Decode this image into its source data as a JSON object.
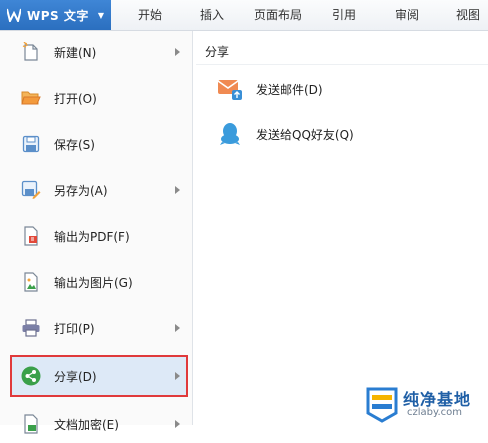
{
  "app_menu": {
    "title": "WPS 文字",
    "caret": "▼"
  },
  "ribbon_tabs": [
    {
      "label": "开始"
    },
    {
      "label": "插入"
    },
    {
      "label": "页面布局"
    },
    {
      "label": "引用"
    },
    {
      "label": "审阅"
    },
    {
      "label": "视图"
    }
  ],
  "file_menu": {
    "items": [
      {
        "label": "新建(N)",
        "icon": "new-document-icon",
        "has_submenu": true
      },
      {
        "label": "打开(O)",
        "icon": "folder-open-icon",
        "has_submenu": false
      },
      {
        "label": "保存(S)",
        "icon": "save-icon",
        "has_submenu": false
      },
      {
        "label": "另存为(A)",
        "icon": "save-as-icon",
        "has_submenu": true
      },
      {
        "label": "输出为PDF(F)",
        "icon": "pdf-export-icon",
        "has_submenu": false
      },
      {
        "label": "输出为图片(G)",
        "icon": "image-export-icon",
        "has_submenu": false
      },
      {
        "label": "打印(P)",
        "icon": "printer-icon",
        "has_submenu": true
      },
      {
        "label": "分享(D)",
        "icon": "share-icon",
        "has_submenu": true,
        "selected": true
      },
      {
        "label": "文档加密(E)",
        "icon": "encrypt-icon",
        "has_submenu": true
      }
    ]
  },
  "share_submenu": {
    "title": "分享",
    "items": [
      {
        "label": "发送邮件(D)",
        "icon": "mail-send-icon"
      },
      {
        "label": "发送给QQ好友(Q)",
        "icon": "qq-icon"
      }
    ]
  },
  "watermark": {
    "text": "纯净基地",
    "subtext": "czlaby.com"
  },
  "colors": {
    "accent": "#2b6fbf",
    "selected_bg": "#dde9f7",
    "highlight_border": "#e0393b",
    "share_green": "#3aa04a",
    "mail_orange": "#f08a52",
    "qq_blue": "#3a9bdc"
  }
}
